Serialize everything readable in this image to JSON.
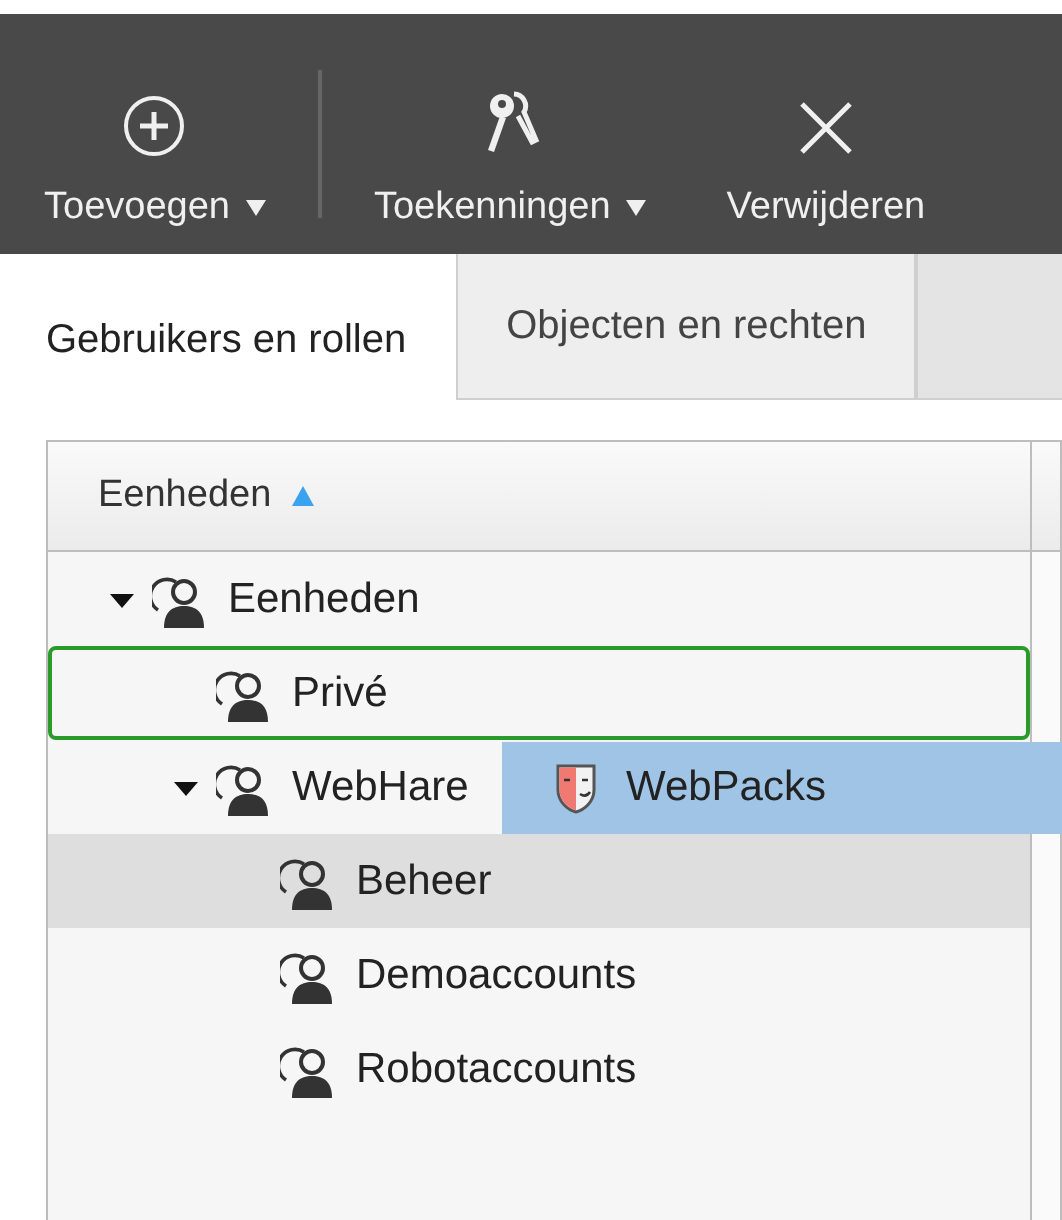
{
  "toolbar": {
    "items": [
      {
        "kind": "button",
        "label": "Toevoegen",
        "dropdown": true
      },
      {
        "kind": "separator"
      },
      {
        "kind": "button",
        "label": "Toekenningen",
        "dropdown": true
      },
      {
        "kind": "button",
        "label": "Verwijderen",
        "dropdown": false
      }
    ]
  },
  "tabs": [
    {
      "label": "Gebruikers en rollen",
      "selected": true
    },
    {
      "label": "Objecten en rechten",
      "selected": false
    }
  ],
  "table": {
    "columns": [
      {
        "label": "Eenheden",
        "sorted_ascending": true
      }
    ],
    "tree": [
      {
        "label": "Eenheden",
        "expanded": true,
        "selected": false,
        "drop_target": false,
        "children": [
          {
            "label": "Privé",
            "selected": false,
            "drop_target": true
          },
          {
            "label": "WebHare",
            "expanded": true,
            "selected": false,
            "drop_target": false,
            "children": [
              {
                "label": "Beheer",
                "selected": true,
                "drop_target": false
              },
              {
                "label": "Demoaccounts",
                "selected": false,
                "drop_target": false
              },
              {
                "label": "Robotaccounts",
                "selected": false,
                "drop_target": false
              }
            ]
          }
        ]
      }
    ]
  },
  "drag_item": {
    "label": "WebPacks"
  }
}
